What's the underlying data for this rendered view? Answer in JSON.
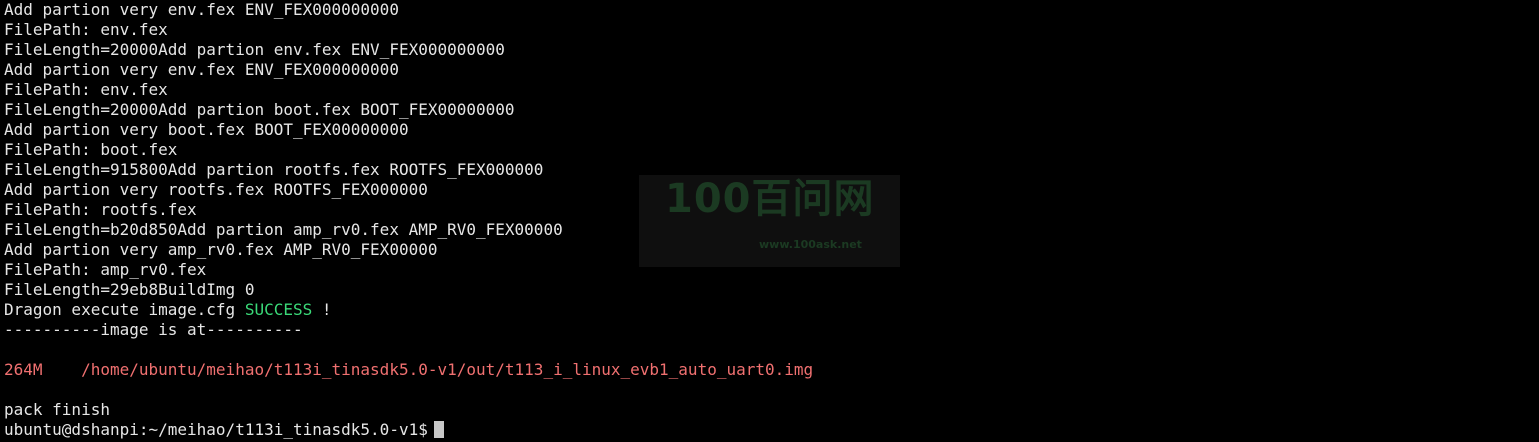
{
  "terminal": {
    "lines": [
      "Add partion very env.fex ENV_FEX000000000",
      "FilePath: env.fex",
      "FileLength=20000Add partion env.fex ENV_FEX000000000",
      "Add partion very env.fex ENV_FEX000000000",
      "FilePath: env.fex",
      "FileLength=20000Add partion boot.fex BOOT_FEX00000000",
      "Add partion very boot.fex BOOT_FEX00000000",
      "FilePath: boot.fex",
      "FileLength=915800Add partion rootfs.fex ROOTFS_FEX000000",
      "Add partion very rootfs.fex ROOTFS_FEX000000",
      "FilePath: rootfs.fex",
      "FileLength=b20d850Add partion amp_rv0.fex AMP_RV0_FEX00000",
      "Add partion very amp_rv0.fex AMP_RV0_FEX00000",
      "FilePath: amp_rv0.fex",
      "FileLength=29eb8BuildImg 0"
    ],
    "dragon": {
      "prefix": "Dragon execute image.cfg ",
      "status": "SUCCESS",
      "suffix": " !"
    },
    "image_header": "----------image is at----------",
    "image_size_line": "264M    /home/ubuntu/meihao/t113i_tinasdk5.0-v1/out/t113_i_linux_evb1_auto_uart0.img",
    "pack_finish": "pack finish",
    "prompt": "ubuntu@dshanpi:~/meihao/t113i_tinasdk5.0-v1$"
  },
  "watermark": {
    "title": "100百问网",
    "url": "www.100ask.net"
  },
  "colors": {
    "background": "#000000",
    "text": "#e6e6e6",
    "success": "#3ad978",
    "path": "#f07070"
  }
}
